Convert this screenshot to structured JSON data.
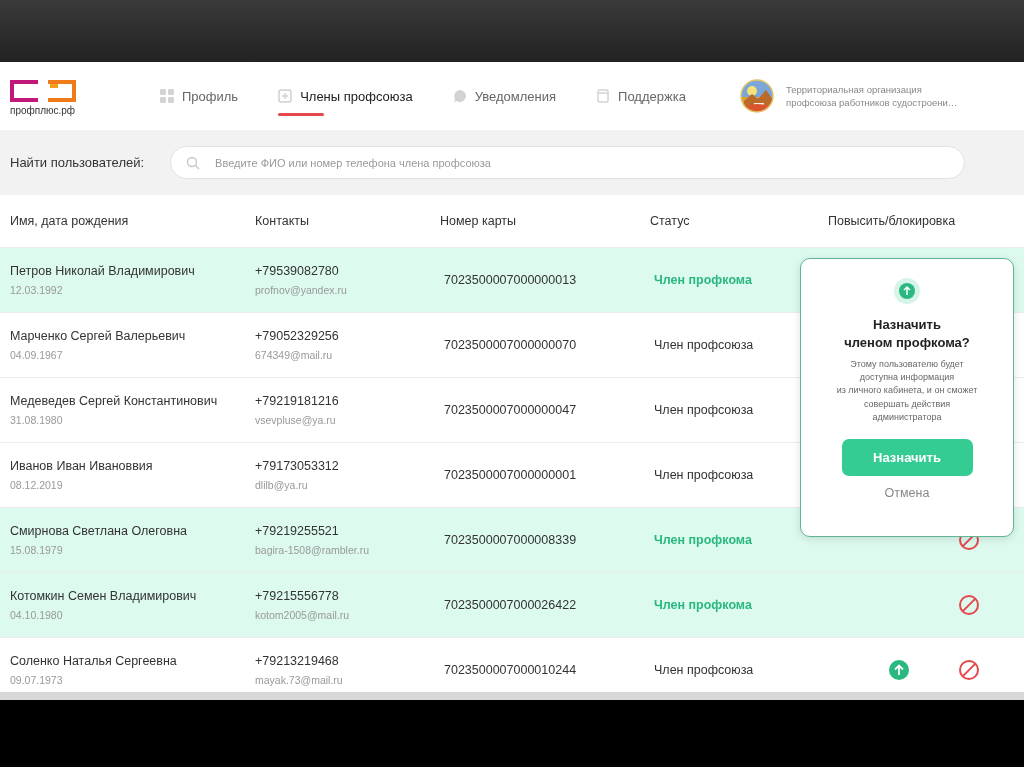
{
  "logo": {
    "text": "профплюс.рф"
  },
  "tabs": [
    {
      "label": "Профиль",
      "selected": false
    },
    {
      "label": "Члены профсоюза",
      "selected": true
    },
    {
      "label": "Уведомления",
      "selected": false
    },
    {
      "label": "Поддержка",
      "selected": false
    }
  ],
  "organization": {
    "lines": [
      "Территориальная организация",
      "профсоюза работников судостроени…"
    ]
  },
  "search": {
    "label": "Найти пользователей:",
    "placeholder": "Введите ФИО или номер телефона члена профсоюза"
  },
  "table": {
    "columns": [
      "Имя, дата рождения",
      "Контакты",
      "Номер карты",
      "Статус",
      "Повысить/блокировка"
    ],
    "rows": [
      {
        "name": "Петров Николай Владимирович",
        "birth_date": "12.03.1992",
        "phone": "+79539082780",
        "email": "profnov@yandex.ru",
        "card": "7023500007000000013",
        "status": "Член профкома",
        "highlighted": true
      },
      {
        "name": "Марченко Сергей Валерьевич",
        "birth_date": "04.09.1967",
        "phone": "+79052329256",
        "email": "674349@mail.ru",
        "card": "7023500007000000070",
        "status": "Член профсоюза",
        "highlighted": false
      },
      {
        "name": "Медеведев Сергей Константинович",
        "birth_date": "31.08.1980",
        "phone": "+79219181216",
        "email": "vsevpluse@ya.ru",
        "card": "7023500007000000047",
        "status": "Член профсоюза",
        "highlighted": false
      },
      {
        "name": "Иванов Иван Ивановвия",
        "birth_date": "08.12.2019",
        "phone": "+79173053312",
        "email": "dlilb@ya.ru",
        "card": "7023500007000000001",
        "status": "Член профсоюза",
        "highlighted": false
      },
      {
        "name": "Смирнова Светлана Олеговна",
        "birth_date": "15.08.1979",
        "phone": "+79219255521",
        "email": "bagira-1508@rambler.ru",
        "card": "7023500007000008339",
        "status": "Член профкома",
        "highlighted": true,
        "block": true
      },
      {
        "name": "Котомкин Семен Владимирович",
        "birth_date": "04.10.1980",
        "phone": "+79215556778",
        "email": "kotom2005@mail.ru",
        "card": "7023500007000026422",
        "status": "Член профкома",
        "highlighted": true,
        "block": true
      },
      {
        "name": "Соленко Наталья Сергеевна",
        "birth_date": "09.07.1973",
        "phone": "+79213219468",
        "email": "mayak.73@mail.ru",
        "card": "7023500007000010244",
        "status": "Член профсоюза",
        "highlighted": false,
        "promote": true,
        "block": true
      }
    ]
  },
  "dialog": {
    "title": "Назначить\nчленом профкома?",
    "text": "Этому пользователю будет\nдоступна информация\nиз личного кабинета, и он сможет\nсовершать действия\nадминистратора",
    "confirm": "Назначить",
    "cancel": "Отмена"
  }
}
